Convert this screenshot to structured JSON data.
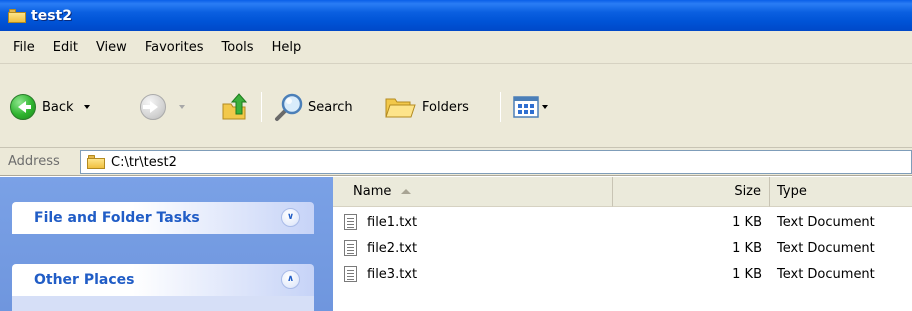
{
  "window": {
    "title": "test2"
  },
  "menu": [
    "File",
    "Edit",
    "View",
    "Favorites",
    "Tools",
    "Help"
  ],
  "toolbar": {
    "back_label": "Back",
    "search_label": "Search",
    "folders_label": "Folders"
  },
  "address": {
    "label": "Address",
    "path": "C:\\tr\\test2"
  },
  "taskpane": {
    "file_folder_tasks": "File and Folder Tasks",
    "other_places": "Other Places"
  },
  "filelist": {
    "columns": {
      "name": "Name",
      "size": "Size",
      "type": "Type"
    },
    "files": [
      {
        "name": "file1.txt",
        "size": "1 KB",
        "type": "Text Document"
      },
      {
        "name": "file2.txt",
        "size": "1 KB",
        "type": "Text Document"
      },
      {
        "name": "file3.txt",
        "size": "1 KB",
        "type": "Text Document"
      }
    ]
  }
}
